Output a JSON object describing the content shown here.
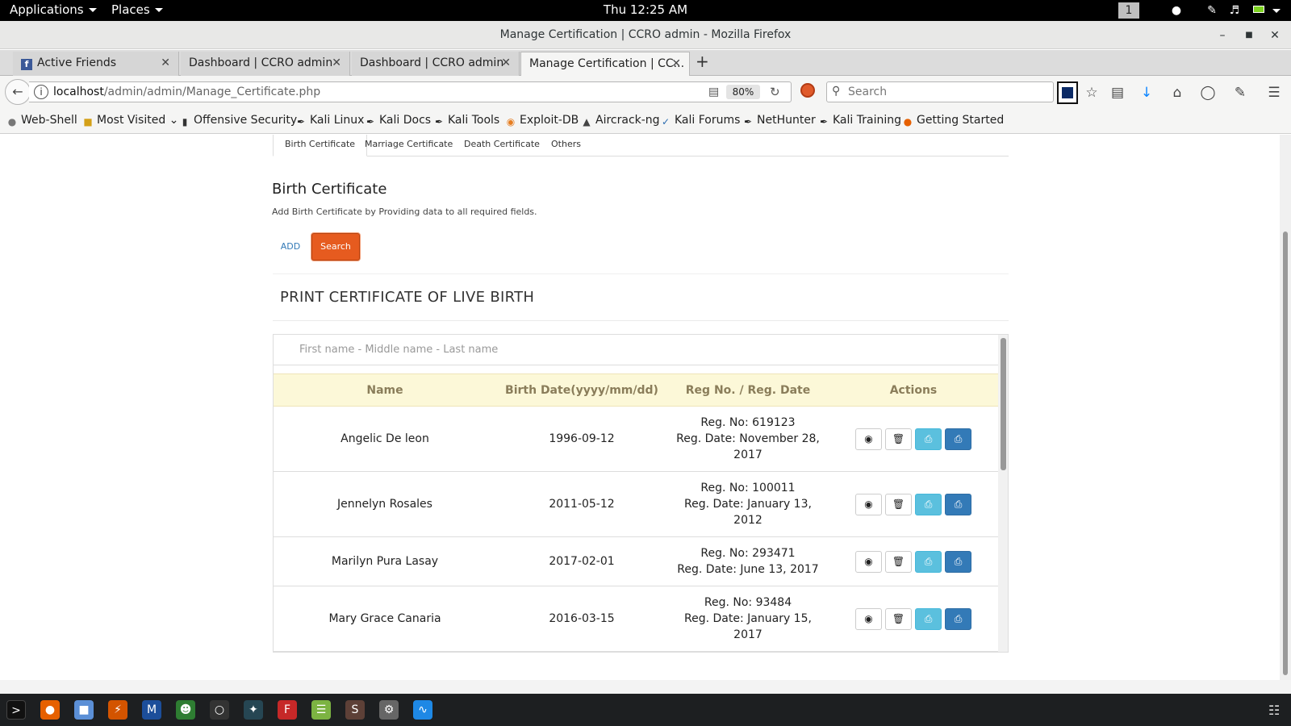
{
  "topbar": {
    "applications": "Applications",
    "places": "Places",
    "clock": "Thu 12:25 AM",
    "workspace": "1"
  },
  "window": {
    "title": "Manage Certification | CCRO admin - Mozilla Firefox"
  },
  "tabs": [
    {
      "label": "Active Friends"
    },
    {
      "label": "Dashboard | CCRO admin"
    },
    {
      "label": "Dashboard | CCRO admin"
    },
    {
      "label": "Manage Certification | CC..."
    }
  ],
  "navbar": {
    "url_host": "localhost",
    "url_path": "/admin/admin/Manage_Certificate.php",
    "zoom": "80%",
    "search_placeholder": "Search"
  },
  "bookmarks": [
    {
      "label": "Web-Shell"
    },
    {
      "label": "Most Visited"
    },
    {
      "label": "Offensive Security"
    },
    {
      "label": "Kali Linux"
    },
    {
      "label": "Kali Docs"
    },
    {
      "label": "Kali Tools"
    },
    {
      "label": "Exploit-DB"
    },
    {
      "label": "Aircrack-ng"
    },
    {
      "label": "Kali Forums"
    },
    {
      "label": "NetHunter"
    },
    {
      "label": "Kali Training"
    },
    {
      "label": "Getting Started"
    }
  ],
  "cert_tabs": [
    {
      "label": "Birth Certificate"
    },
    {
      "label": "Marriage Certificate"
    },
    {
      "label": "Death Certificate"
    },
    {
      "label": "Others"
    }
  ],
  "section": {
    "title": "Birth Certificate",
    "description": "Add Birth Certificate by Providing data to all required fields.",
    "add_label": "ADD",
    "search_label": "Search"
  },
  "print_panel": {
    "title": "PRINT CERTIFICATE OF LIVE BIRTH",
    "filter_placeholder": "First name - Middle name - Last name"
  },
  "table": {
    "headers": [
      "Name",
      "Birth Date(yyyy/mm/dd)",
      "Reg No. / Reg. Date",
      "Actions"
    ],
    "rows": [
      {
        "name": "Angelic De leon",
        "birth_date": "1996-09-12",
        "reg_no": "Reg. No:  619123",
        "reg_date": "Reg. Date:  November 28, 2017"
      },
      {
        "name": "Jennelyn Rosales",
        "birth_date": "2011-05-12",
        "reg_no": "Reg. No:  100011",
        "reg_date": "Reg. Date:  January 13, 2012"
      },
      {
        "name": "Marilyn Pura Lasay",
        "birth_date": "2017-02-01",
        "reg_no": "Reg. No:  293471",
        "reg_date": "Reg. Date:  June 13, 2017"
      },
      {
        "name": "Mary Grace Canaria",
        "birth_date": "2016-03-15",
        "reg_no": "Reg. No:  93484",
        "reg_date": "Reg. Date:  January 15, 2017"
      }
    ]
  },
  "colors": {
    "search_button": "#e65b1f",
    "table_header_bg": "#fcf8d8",
    "print_light": "#5bc0de",
    "print_dark": "#337ab7"
  }
}
